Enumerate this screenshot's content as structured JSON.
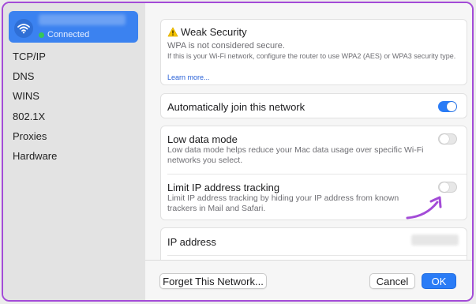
{
  "sidebar": {
    "network": {
      "status": "Connected",
      "icon": "wifi-icon"
    },
    "items": [
      {
        "label": "TCP/IP"
      },
      {
        "label": "DNS"
      },
      {
        "label": "WINS"
      },
      {
        "label": "802.1X"
      },
      {
        "label": "Proxies"
      },
      {
        "label": "Hardware"
      }
    ]
  },
  "security": {
    "title": "Weak Security",
    "subtitle": "WPA is not considered secure.",
    "description": "If this is your Wi-Fi network, configure the router to use WPA2 (AES) or WPA3 security type.",
    "link": "Learn more..."
  },
  "auto_join": {
    "label": "Automatically join this network",
    "enabled": true
  },
  "low_data": {
    "label": "Low data mode",
    "description": "Low data mode helps reduce your Mac data usage over specific Wi-Fi networks you select.",
    "enabled": false
  },
  "limit_ip": {
    "label": "Limit IP address tracking",
    "description": "Limit IP address tracking by hiding your IP address from known trackers in Mail and Safari.",
    "enabled": false
  },
  "ip": {
    "label": "IP address"
  },
  "footer": {
    "forget_label": "Forget This Network...",
    "cancel_label": "Cancel",
    "ok_label": "OK"
  },
  "colors": {
    "accent": "#2a7cf6",
    "annotation_arrow": "#a34bd7",
    "warning": "#f5c400"
  }
}
